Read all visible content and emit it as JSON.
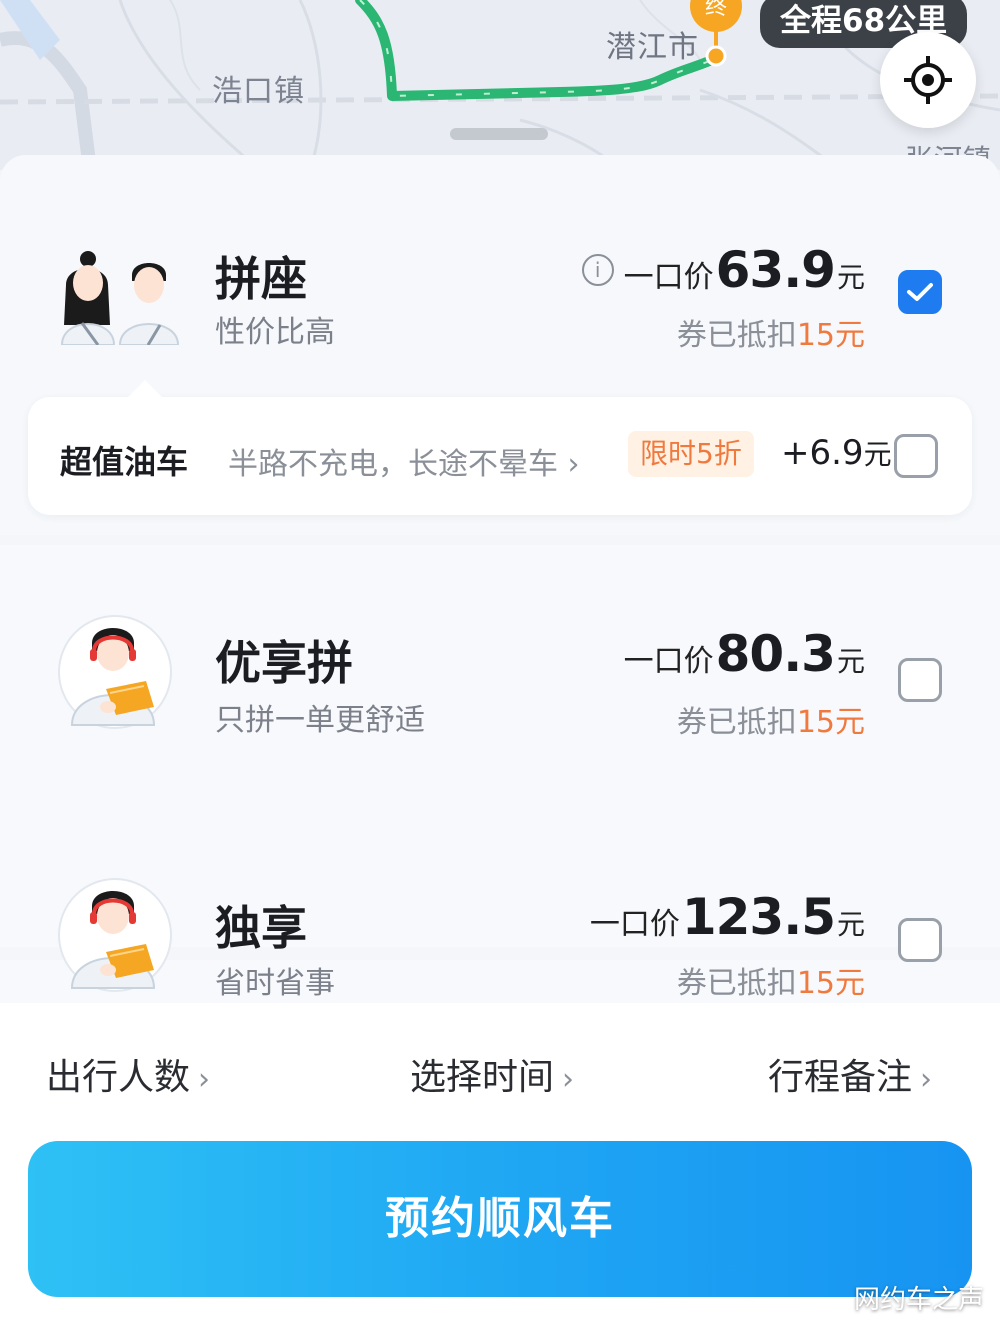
{
  "map": {
    "labels": {
      "town": "浩口镇",
      "city": "潜江市",
      "edge": "张河镇"
    },
    "end_marker": "终",
    "distance": "全程68公里",
    "route_color": "#2bb673"
  },
  "options": [
    {
      "name": "拼座",
      "subtitle": "性价比高",
      "price_prefix": "一口价",
      "price_value": "63.9",
      "price_unit": "元",
      "coupon_text": "券已抵扣",
      "coupon_amount": "15元",
      "selected": true,
      "addon": {
        "title": "超值油车",
        "desc": "半路不充电，长途不晕车 ›",
        "badge": "限时5折",
        "price": "+6.9",
        "price_unit": "元",
        "selected": false
      }
    },
    {
      "name": "优享拼",
      "subtitle": "只拼一单更舒适",
      "price_prefix": "一口价",
      "price_value": "80.3",
      "price_unit": "元",
      "coupon_text": "券已抵扣",
      "coupon_amount": "15元",
      "selected": false
    },
    {
      "name": "独享",
      "subtitle": "省时省事",
      "price_prefix": "一口价",
      "price_value": "123.5",
      "price_unit": "元",
      "coupon_text": "券已抵扣",
      "coupon_amount": "15元",
      "selected": false
    }
  ],
  "bottom": {
    "passengers": "出行人数",
    "time": "选择时间",
    "notes": "行程备注",
    "chevron": "›",
    "book_button": "预约顺风车"
  },
  "watermark": "网约车之声",
  "colors": {
    "accent": "#1f7bf0",
    "coupon": "#f07a3e",
    "button_gradient_start": "#2ec1f5",
    "button_gradient_end": "#1794f2"
  }
}
